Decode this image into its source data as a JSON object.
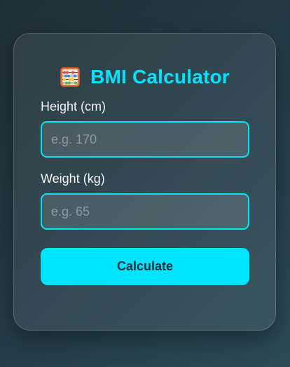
{
  "app": {
    "title": "BMI Calculator",
    "icon": "abacus-icon"
  },
  "form": {
    "height": {
      "label": "Height (cm)",
      "placeholder": "e.g. 170",
      "value": ""
    },
    "weight": {
      "label": "Weight (kg)",
      "placeholder": "e.g. 65",
      "value": ""
    },
    "submit_label": "Calculate"
  },
  "colors": {
    "accent": "#00e5ff",
    "button_text": "#16313a",
    "label_text": "#f2f5f7"
  }
}
